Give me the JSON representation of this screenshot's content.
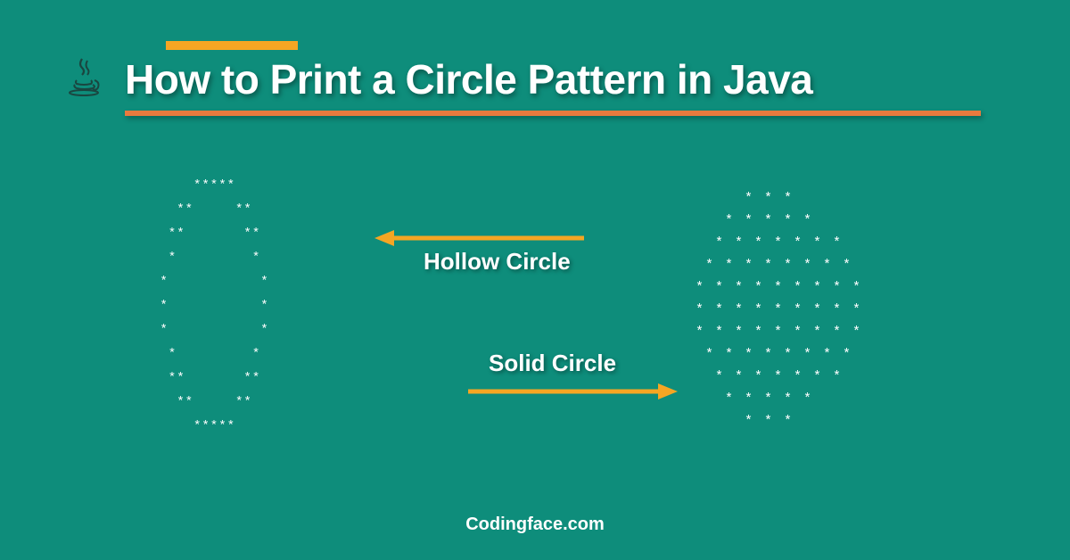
{
  "title": "How to Print a Circle Pattern in Java",
  "labels": {
    "hollow": "Hollow Circle",
    "solid": "Solid Circle"
  },
  "footer": "Codingface.com",
  "colors": {
    "background": "#0e8d7b",
    "accent_yellow": "#f5a623",
    "accent_orange": "#e87a3e",
    "text": "#ffffff"
  },
  "patterns": {
    "hollow": "     *****\n   **     **\n  **       **\n  *         *\n *           *\n *           *\n *           *\n  *         *\n  **       **\n   **     **\n     *****",
    "solid": "     * * *\n   * * * * *\n  * * * * * * *\n * * * * * * * *\n* * * * * * * * *\n* * * * * * * * *\n* * * * * * * * *\n * * * * * * * *\n  * * * * * * *\n   * * * * *\n     * * *"
  }
}
